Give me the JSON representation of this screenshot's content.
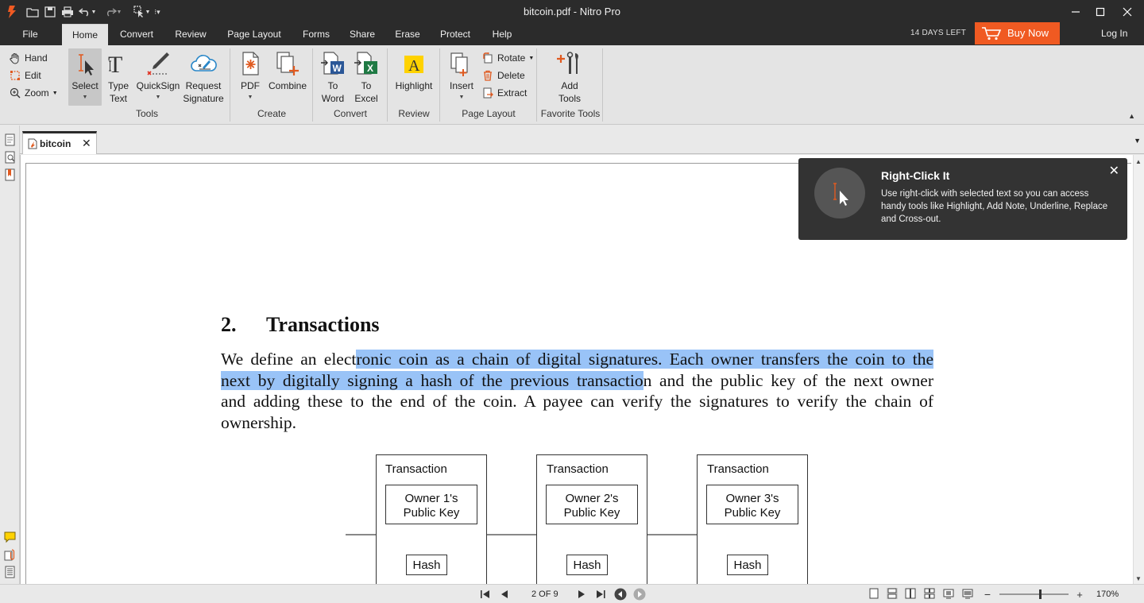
{
  "window": {
    "title": "bitcoin.pdf - Nitro Pro"
  },
  "menu": {
    "file": "File",
    "tabs": [
      "Home",
      "Convert",
      "Review",
      "Page Layout",
      "Forms",
      "Share",
      "Erase",
      "Protect",
      "Help"
    ],
    "active_tab": "Home",
    "trial": "14 DAYS LEFT",
    "buy": "Buy Now",
    "login": "Log In"
  },
  "ribbon": {
    "nav": {
      "hand": "Hand",
      "edit": "Edit",
      "zoom": "Zoom"
    },
    "tools": {
      "select": "Select",
      "type_text_1": "Type",
      "type_text_2": "Text",
      "quicksign": "QuickSign",
      "request_1": "Request",
      "request_2": "Signature",
      "group": "Tools"
    },
    "create": {
      "pdf": "PDF",
      "combine": "Combine",
      "group": "Create"
    },
    "convert": {
      "to_word_1": "To",
      "to_word_2": "Word",
      "to_excel_1": "To",
      "to_excel_2": "Excel",
      "group": "Convert"
    },
    "review": {
      "highlight": "Highlight",
      "group": "Review"
    },
    "page_layout": {
      "insert": "Insert",
      "rotate": "Rotate",
      "delete": "Delete",
      "extract": "Extract",
      "group": "Page Layout"
    },
    "favorite": {
      "add_1": "Add",
      "add_2": "Tools",
      "group": "Favorite Tools"
    }
  },
  "document_tab": {
    "label": "bitcoin"
  },
  "tooltip": {
    "title": "Right-Click It",
    "body": "Use right-click with selected text so you can access handy tools like Highlight, Add Note, Underline, Replace and Cross-out."
  },
  "document": {
    "section_number": "2.",
    "section_title": "Transactions",
    "lines": [
      {
        "pre": "We define an elect",
        "hl": "ronic coin as a chain of digital signatures.  Each owner transfers the coin to the",
        "post": ""
      },
      {
        "pre": "",
        "hl": "next by digitally signing a hash of the previous transactio",
        "post": "n and the public key of the next owner"
      },
      {
        "pre": "and adding these to the end of the coin.  A payee can verify the signatures to verify the chain of",
        "hl": "",
        "post": ""
      },
      {
        "pre": "ownership.",
        "hl": "",
        "post": ""
      }
    ],
    "diagram": {
      "blocks": [
        {
          "title": "Transaction",
          "key_1": "Owner 1's",
          "key_2": "Public Key",
          "hash": "Hash"
        },
        {
          "title": "Transaction",
          "key_1": "Owner 2's",
          "key_2": "Public Key",
          "hash": "Hash"
        },
        {
          "title": "Transaction",
          "key_1": "Owner 3's",
          "key_2": "Public Key",
          "hash": "Hash"
        }
      ]
    }
  },
  "statusbar": {
    "page": "2 OF 9",
    "zoom": "170%",
    "zoom_fraction": 0.6
  },
  "colors": {
    "accent": "#f05a22",
    "selection": "#99c3f7",
    "titlebar": "#2b2b2b"
  }
}
